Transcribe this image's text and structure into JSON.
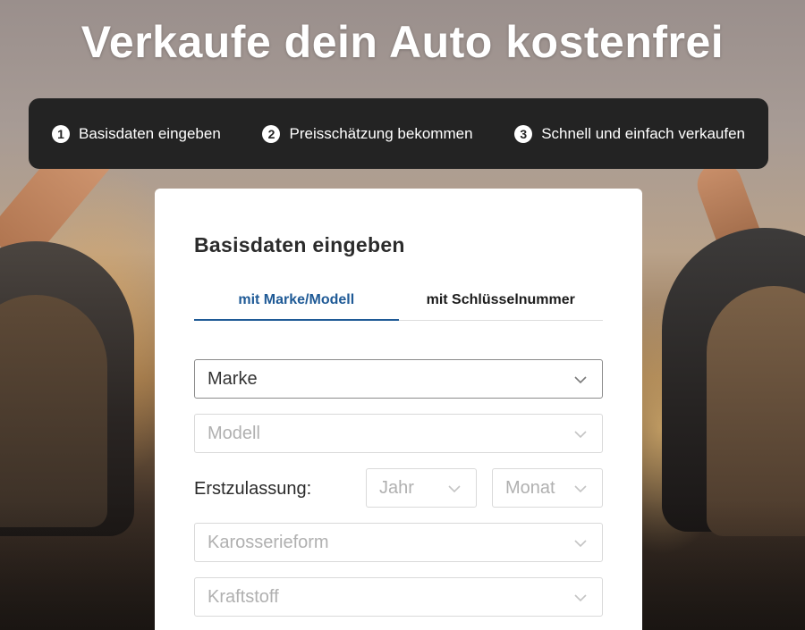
{
  "hero": {
    "title": "Verkaufe dein Auto kostenfrei"
  },
  "steps": [
    {
      "number": "1",
      "label": "Basisdaten eingeben"
    },
    {
      "number": "2",
      "label": "Preisschätzung bekommen"
    },
    {
      "number": "3",
      "label": "Schnell und einfach verkaufen"
    }
  ],
  "form": {
    "title": "Basisdaten eingeben",
    "tabs": [
      {
        "label": "mit Marke/Modell",
        "active": true
      },
      {
        "label": "mit Schlüsselnummer",
        "active": false
      }
    ],
    "fields": {
      "marke": "Marke",
      "modell": "Modell",
      "erstzulassung_label": "Erstzulassung:",
      "jahr": "Jahr",
      "monat": "Monat",
      "karosserieform": "Karosserieform",
      "kraftstoff": "Kraftstoff"
    }
  },
  "colors": {
    "accent": "#1f5a96",
    "steps_bar": "#232323",
    "placeholder_text": "#b0b0b0"
  },
  "icons": {
    "dropdown": "chevron-down-icon"
  }
}
